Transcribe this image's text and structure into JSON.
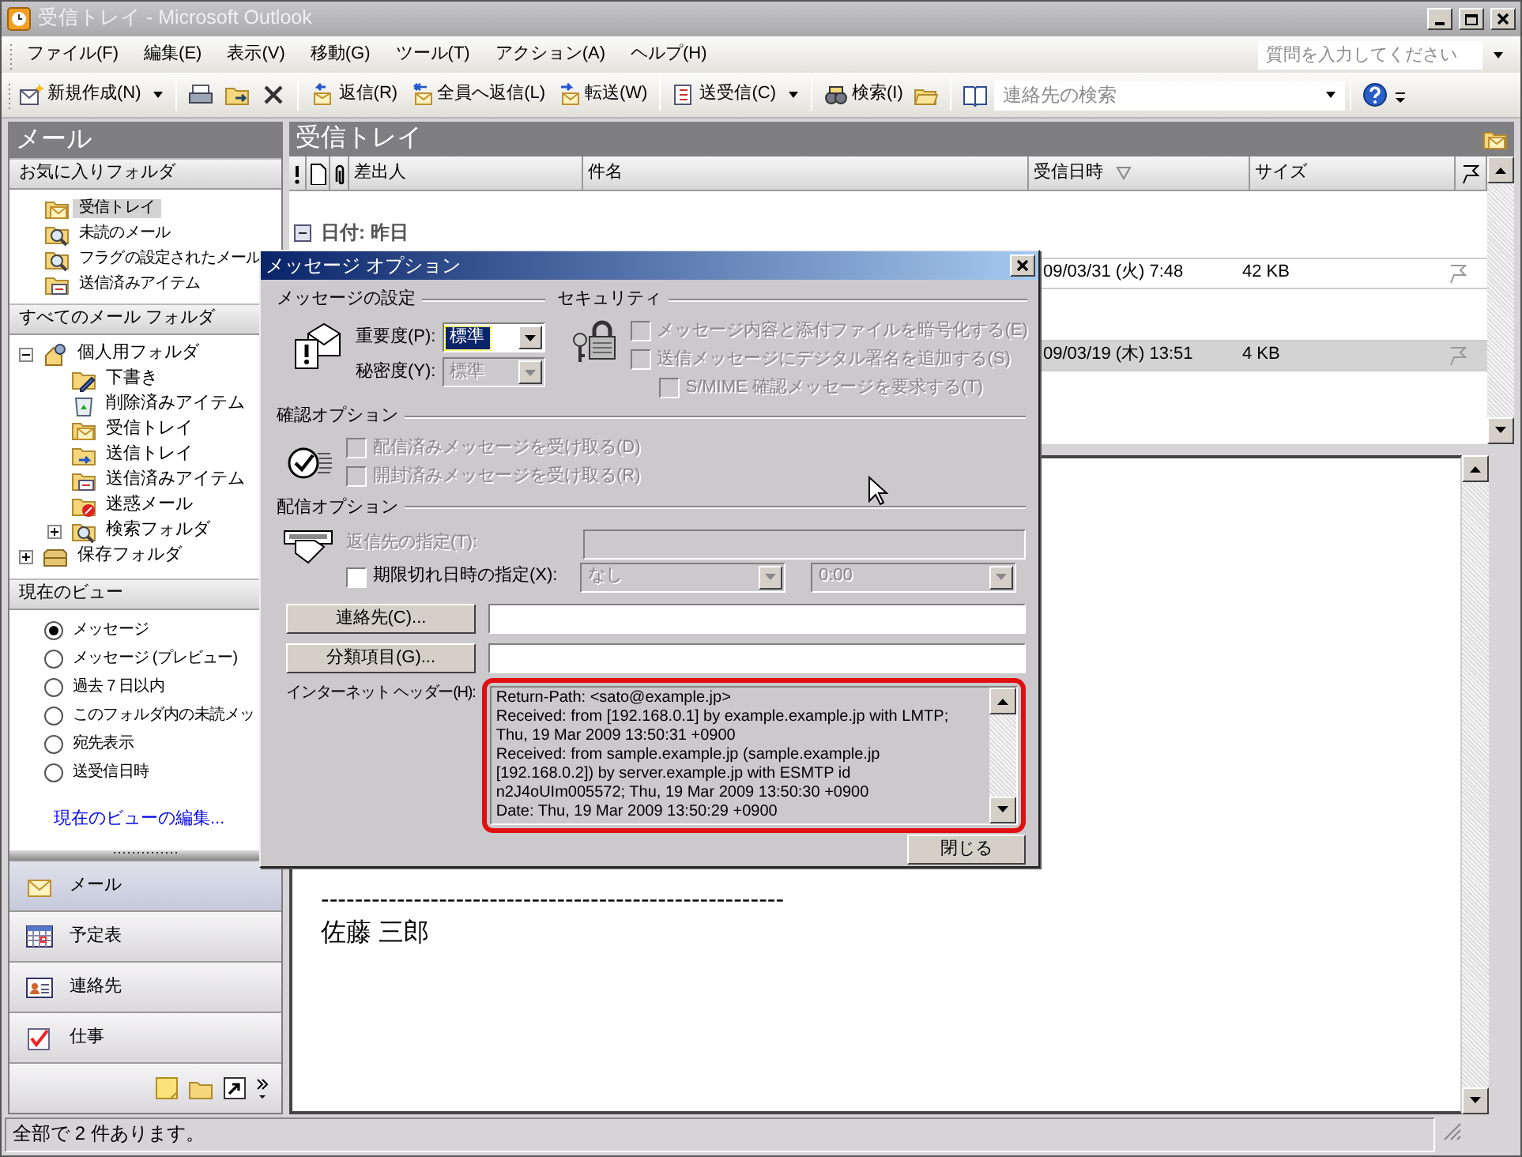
{
  "window": {
    "title": "受信トレイ - Microsoft Outlook"
  },
  "menu": [
    "ファイル(F)",
    "編集(E)",
    "表示(V)",
    "移動(G)",
    "ツール(T)",
    "アクション(A)",
    "ヘルプ(H)"
  ],
  "help_search": {
    "placeholder": "質問を入力してください"
  },
  "toolbar": [
    {
      "kind": "button",
      "label": "新規作成(N)",
      "dropdown": true
    },
    {
      "kind": "separator"
    },
    {
      "kind": "icon"
    },
    {
      "kind": "icon"
    },
    {
      "kind": "icon"
    },
    {
      "kind": "separator"
    },
    {
      "kind": "button",
      "label": "返信(R)",
      "dropdown": false
    },
    {
      "kind": "button",
      "label": "全員へ返信(L)",
      "dropdown": false
    },
    {
      "kind": "button",
      "label": "転送(W)",
      "dropdown": false
    },
    {
      "kind": "separator"
    },
    {
      "kind": "button",
      "label": "送受信(C)",
      "dropdown": true
    },
    {
      "kind": "separator"
    },
    {
      "kind": "button",
      "label": "検索(I)",
      "dropdown": false
    },
    {
      "kind": "icon"
    },
    {
      "kind": "separator"
    },
    {
      "kind": "icon"
    },
    {
      "kind": "search",
      "placeholder": "連絡先の検索"
    },
    {
      "kind": "separator"
    },
    {
      "kind": "icon"
    }
  ],
  "nav_pane": {
    "title": "メール",
    "favorites": {
      "heading": "お気に入りフォルダ",
      "items": [
        {
          "label": "受信トレイ",
          "selected": true
        },
        {
          "label": "未読のメール",
          "selected": false
        },
        {
          "label": "フラグの設定されたメール",
          "selected": false
        },
        {
          "label": "送信済みアイテム",
          "selected": false
        }
      ]
    },
    "all_folders": {
      "heading": "すべてのメール フォルダ",
      "tree": [
        {
          "label": "個人用フォルダ",
          "expanded": true,
          "children": [
            {
              "label": "下書き"
            },
            {
              "label": "削除済みアイテム"
            },
            {
              "label": "受信トレイ"
            },
            {
              "label": "送信トレイ"
            },
            {
              "label": "送信済みアイテム"
            },
            {
              "label": "迷惑メール"
            },
            {
              "label": "検索フォルダ",
              "expanded": false
            }
          ]
        },
        {
          "label": "保存フォルダ",
          "expanded": false
        }
      ]
    },
    "current_view": {
      "heading": "現在のビュー",
      "options": [
        {
          "label": "メッセージ",
          "selected": true
        },
        {
          "label": "メッセージ (プレビュー)",
          "selected": false
        },
        {
          "label": "過去 7 日以内",
          "selected": false
        },
        {
          "label": "このフォルダ内の未読メッ",
          "selected": false
        },
        {
          "label": "宛先表示",
          "selected": false
        },
        {
          "label": "送受信日時",
          "selected": false
        }
      ],
      "link": "現在のビューの編集..."
    },
    "nav_buttons": [
      {
        "label": "メール",
        "selected": true
      },
      {
        "label": "予定表",
        "selected": false
      },
      {
        "label": "連絡先",
        "selected": false
      },
      {
        "label": "仕事",
        "selected": false
      }
    ]
  },
  "inbox": {
    "title": "受信トレイ",
    "columns": [
      {
        "label": "差出人",
        "sorted": false
      },
      {
        "label": "件名",
        "sorted": false
      },
      {
        "label": "受信日時",
        "sorted": true
      },
      {
        "label": "サイズ",
        "sorted": false
      }
    ],
    "group": {
      "label": "日付: 昨日",
      "expanded": true
    },
    "rows": [
      {
        "received": "09/03/31 (火) 7:48",
        "size": "42 KB",
        "selected": false
      },
      {
        "received": "09/03/19 (木) 13:51",
        "size": "4 KB",
        "selected": true
      }
    ]
  },
  "reading_pane": {
    "separator": "-------------------------------------------------------",
    "signature": "佐藤 三郎"
  },
  "dialog": {
    "title": "メッセージ オプション",
    "message_settings": {
      "heading": "メッセージの設定",
      "importance": {
        "label": "重要度(P):",
        "value": "標準",
        "focused": true,
        "disabled": false
      },
      "sensitivity": {
        "label": "秘密度(Y):",
        "value": "標準",
        "focused": false,
        "disabled": true
      }
    },
    "security": {
      "heading": "セキュリティ",
      "options": [
        {
          "label": "メッセージ内容と添付ファイルを暗号化する(E)",
          "checked": false,
          "disabled": true
        },
        {
          "label": "送信メッセージにデジタル署名を追加する(S)",
          "checked": false,
          "disabled": true,
          "children": [
            {
              "label": "S/MIME 確認メッセージを要求する(T)",
              "checked": false,
              "disabled": true
            }
          ]
        }
      ]
    },
    "tracking": {
      "heading": "確認オプション",
      "options": [
        {
          "label": "配信済みメッセージを受け取る(D)",
          "checked": false,
          "disabled": true
        },
        {
          "label": "開封済みメッセージを受け取る(R)",
          "checked": false,
          "disabled": true
        }
      ]
    },
    "delivery": {
      "heading": "配信オプション",
      "reply_to": {
        "label": "返信先の指定(T):",
        "disabled": true
      },
      "expires": {
        "label": "期限切れ日時の指定(X):",
        "checked": false,
        "disabled": false,
        "date": "なし",
        "time": "0:00"
      }
    },
    "contacts_button": "連絡先(C)...",
    "categories_button": "分類項目(G)...",
    "headers": {
      "label": "インターネット ヘッダー(H):",
      "highlighted": true,
      "lines": [
        "Return-Path: <sato@example.jp>",
        "Received: from [192.168.0.1] by example.example.jp with LMTP;",
        "Thu, 19 Mar 2009 13:50:31 +0900",
        "Received: from sample.example.jp (sample.example.jp",
        "[192.168.0.2]) by server.example.jp with ESMTP id",
        "n2J4oUIm005572; Thu, 19 Mar 2009 13:50:30 +0900",
        "Date: Thu, 19 Mar 2009 13:50:29 +0900"
      ]
    },
    "close_button": "閉じる"
  },
  "status_bar": "全部で 2 件あります。"
}
